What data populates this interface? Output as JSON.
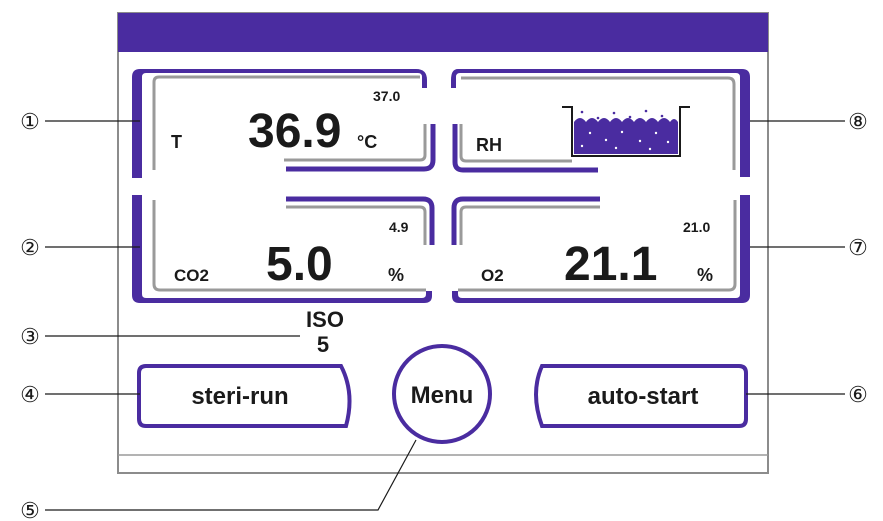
{
  "colors": {
    "accent": "#4a2ca0",
    "frame": "#8c8c8c",
    "panel_border": "#9a9a9a",
    "text": "#1a1a1a"
  },
  "tiles": {
    "temperature": {
      "label": "T",
      "value": "36.9",
      "unit": "°C",
      "setpoint": "37.0"
    },
    "humidity": {
      "label": "RH",
      "icon": "water-tank-icon"
    },
    "co2": {
      "label": "CO2",
      "value": "5.0",
      "unit": "%",
      "setpoint": "4.9"
    },
    "o2": {
      "label": "O2",
      "value": "21.1",
      "unit": "%",
      "setpoint": "21.0"
    }
  },
  "iso": {
    "line1": "ISO",
    "line2": "5"
  },
  "buttons": {
    "steri_run": "steri-run",
    "menu": "Menu",
    "auto_start": "auto-start"
  },
  "callouts": [
    "①",
    "②",
    "③",
    "④",
    "⑤",
    "⑥",
    "⑦",
    "⑧"
  ]
}
